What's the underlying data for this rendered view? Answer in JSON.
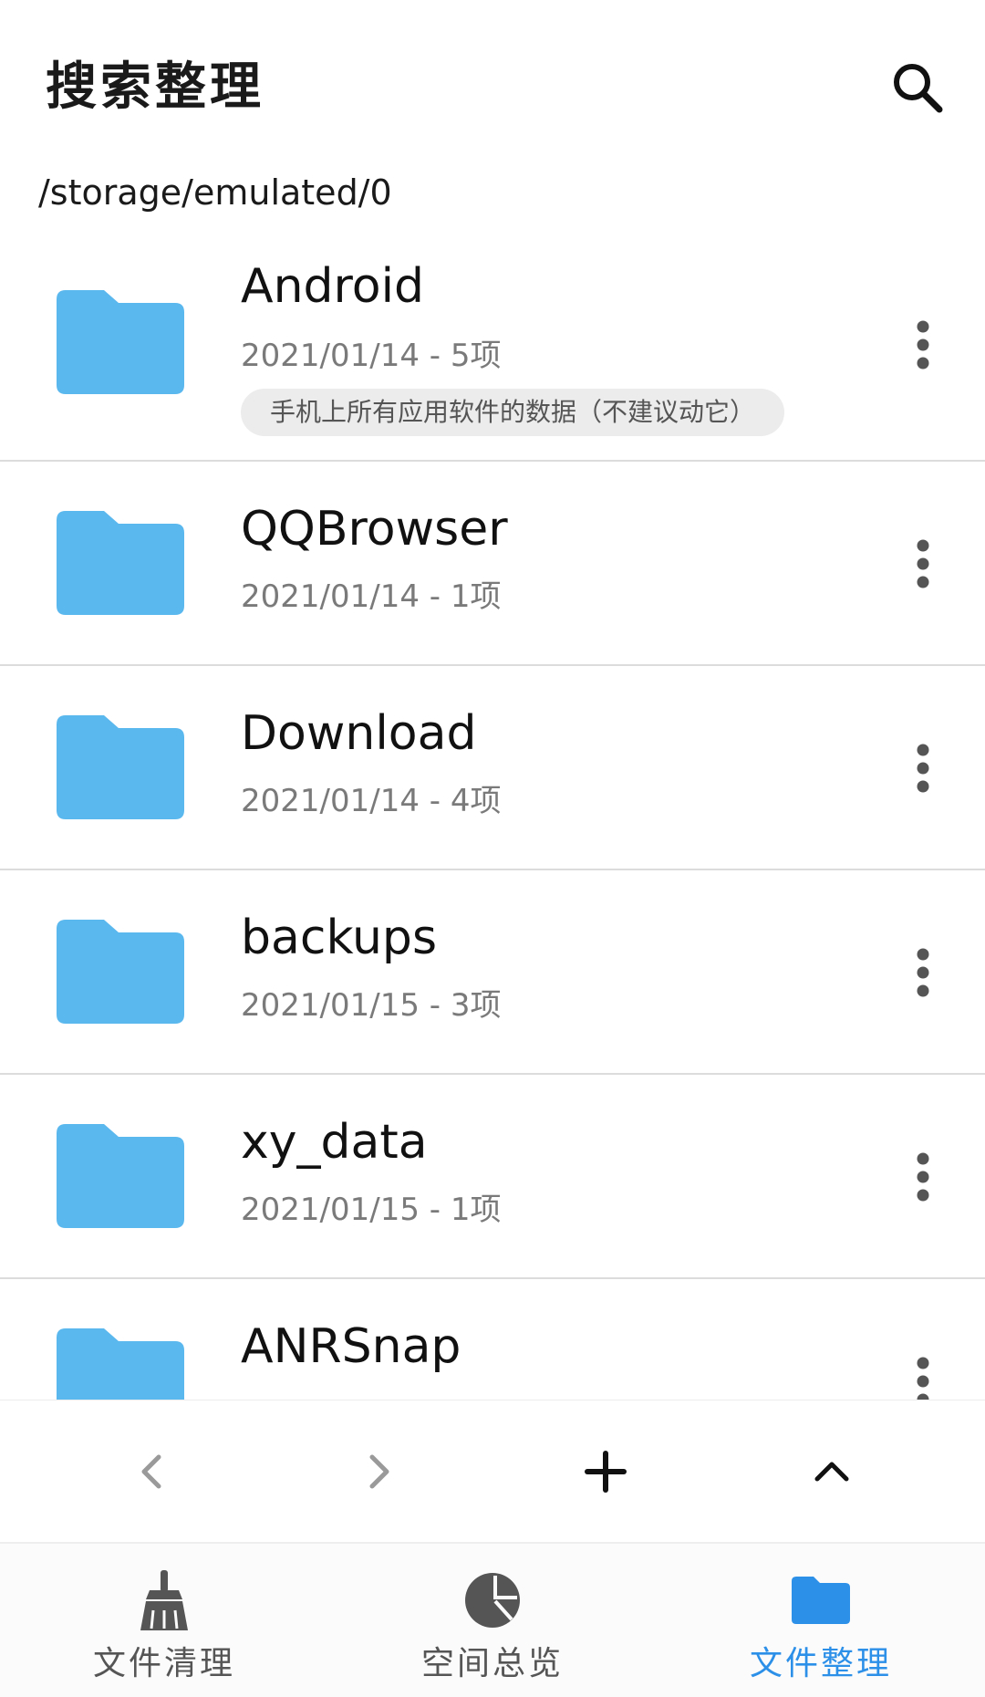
{
  "header": {
    "title": "搜索整理",
    "search_icon": "search-icon"
  },
  "current_path": "/storage/emulated/0",
  "colors": {
    "folder": "#5bb8ee",
    "accent": "#2c8fe8",
    "secondary_text": "#7a7a7a",
    "note_bg": "#ececec"
  },
  "files": [
    {
      "name": "Android",
      "meta": "2021/01/14 - 5项",
      "note": "手机上所有应用软件的数据（不建议动它）"
    },
    {
      "name": "QQBrowser",
      "meta": "2021/01/14 - 1项"
    },
    {
      "name": "Download",
      "meta": "2021/01/14 - 4项"
    },
    {
      "name": "backups",
      "meta": "2021/01/15 - 3项"
    },
    {
      "name": "xy_data",
      "meta": "2021/01/15 - 1项"
    },
    {
      "name": "ANRSnap",
      "meta": ""
    }
  ],
  "action_bar": {
    "back_icon": "chevron-left-icon",
    "forward_icon": "chevron-right-icon",
    "add_icon": "plus-icon",
    "up_icon": "chevron-up-icon"
  },
  "bottom_nav": {
    "items": [
      {
        "label": "文件清理",
        "icon": "broom-icon",
        "active": false
      },
      {
        "label": "空间总览",
        "icon": "pie-chart-icon",
        "active": false
      },
      {
        "label": "文件整理",
        "icon": "folder-icon",
        "active": true
      }
    ]
  }
}
